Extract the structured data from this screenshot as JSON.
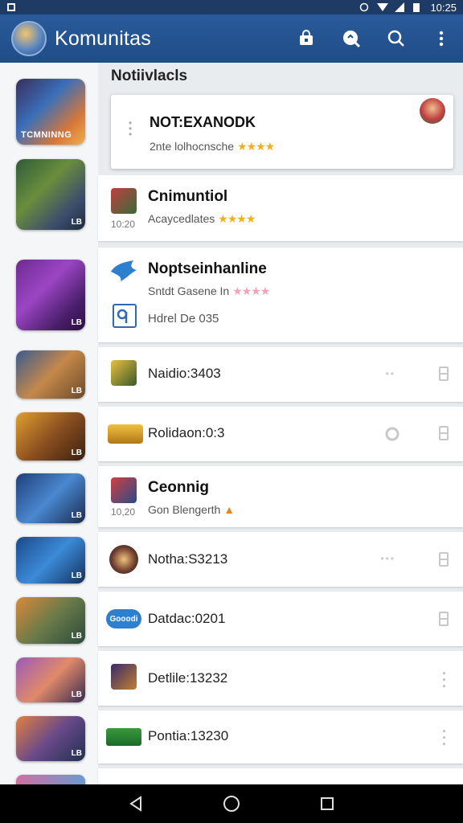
{
  "status_bar": {
    "time": "10:25"
  },
  "app_bar": {
    "title": "Komunitas",
    "actions": [
      "bag-icon",
      "search-badge-icon",
      "search-icon",
      "more-vertical-icon"
    ]
  },
  "section": {
    "title": "Notiivlacls"
  },
  "featured": {
    "title": "NOT:EXANODK",
    "subtitle": "2nte lolhocnsche",
    "stars": "★★★★"
  },
  "cards": [
    {
      "title": "Cnimuntiol",
      "subtitle": "Acaycedlates",
      "time": "10:20",
      "stars": "★★★★"
    },
    {
      "title": "Noptseinhanline",
      "subtitle": "Sntdt Gasene In",
      "stars": "★★★★",
      "footer": "Hdrel De 035"
    },
    {
      "label": "Naidio:3403"
    },
    {
      "label": "Rolidaon:0:3"
    },
    {
      "title": "Ceonnig",
      "subtitle": "Gon Blengerth",
      "time": "10,20"
    },
    {
      "label": "Notha:S3213"
    },
    {
      "label": "Datdac:0201",
      "icon_text": "Gooodi"
    },
    {
      "label": "Detlile:13232"
    },
    {
      "label": "Pontia:13230"
    }
  ],
  "thumbs": [
    {
      "banner": "TCMNINNG"
    },
    {
      "badge": "LB"
    },
    {
      "badge": "LB"
    },
    {
      "badge": "LB"
    },
    {
      "badge": "LB"
    },
    {
      "badge": "LB"
    },
    {
      "badge": "LB"
    },
    {
      "badge": "LB"
    },
    {
      "badge": "LB"
    },
    {
      "badge": "LB"
    }
  ],
  "colors": {
    "app_bar": "#1f4d88",
    "status_bar": "#1d3b64",
    "star": "#f2b01e"
  }
}
